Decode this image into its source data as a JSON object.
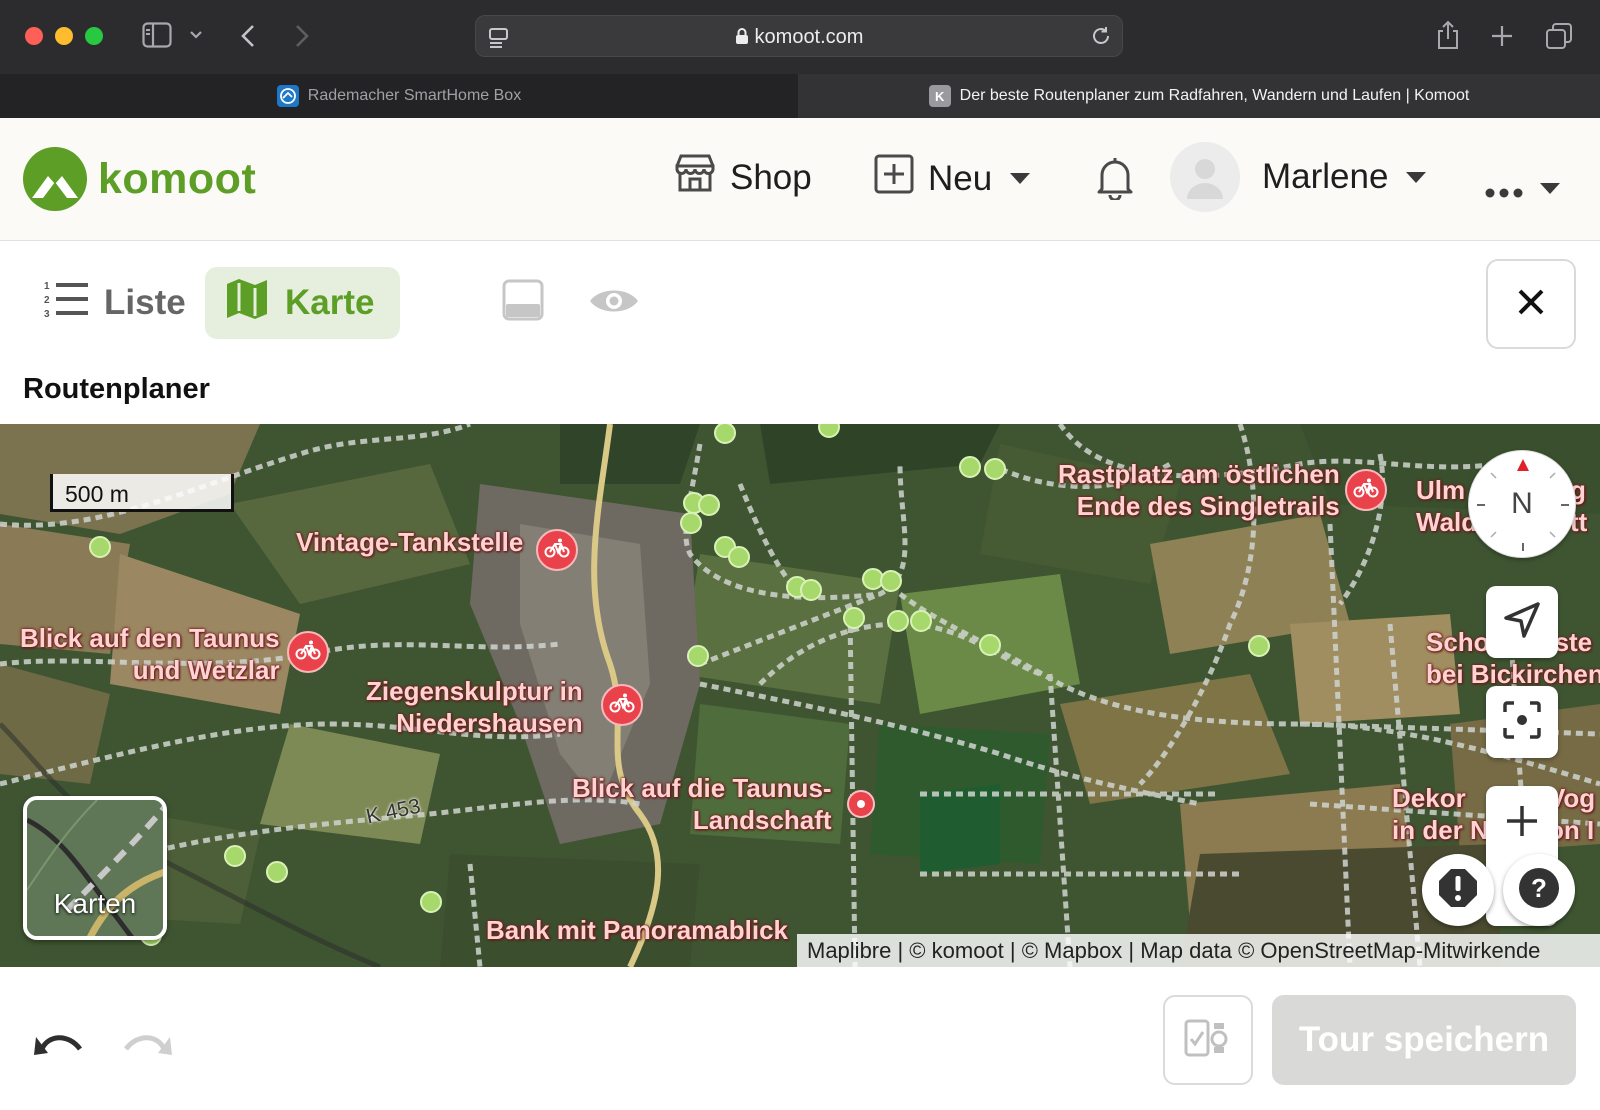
{
  "browser": {
    "url": "komoot.com",
    "tabs": [
      {
        "title": "Rademacher SmartHome Box",
        "active": false
      },
      {
        "title": "Der beste Routenplaner zum Radfahren, Wandern und Laufen | Komoot",
        "active": true,
        "favicon_letter": "K"
      }
    ]
  },
  "header": {
    "brand": "komoot",
    "shop": "Shop",
    "new": "Neu",
    "user": "Marlene"
  },
  "toolbar": {
    "list": "Liste",
    "map": "Karte"
  },
  "section_title": "Routenplaner",
  "map": {
    "scale": "500 m",
    "compass": "N",
    "road": "K 453",
    "layers_label": "Karten",
    "attribution": "Maplibre | © komoot | © Mapbox | Map data © OpenStreetMap-Mitwirkende",
    "labels": {
      "tankstelle": "Vintage-Tankstelle",
      "taunus_line1": "Blick auf den Taunus",
      "taunus_line2": "und Wetzlar",
      "ziege_line1": "Ziegenskulptur in",
      "ziege_line2": "Niedershausen",
      "landschaft_line1": "Blick auf die Taunus-",
      "landschaft_line2": "Landschaft",
      "bank": "Bank mit Panoramablick",
      "rastplatz_line1": "Rastplatz am östlichen",
      "rastplatz_line2": "Ende des Singletrails",
      "ulm_line1": "Ulm",
      "ulm_line2": "Wald",
      "ulm_tail1": "g",
      "ulm_tail2": "tt",
      "schotter_line1": "Schotterpiste",
      "schotter_line2": "bei Bickirchen",
      "dekor_line1": "Dekor",
      "dekor_line2": "in der N",
      "dekor_tail1": "Vog",
      "dekor_tail2": "on I"
    }
  },
  "bottom": {
    "save": "Tour speichern"
  },
  "colors": {
    "brand_green": "#5c9e26",
    "poi_red": "#e9424b",
    "highlight_green": "#a6d86b",
    "active_view_bg": "#e6efdd"
  }
}
